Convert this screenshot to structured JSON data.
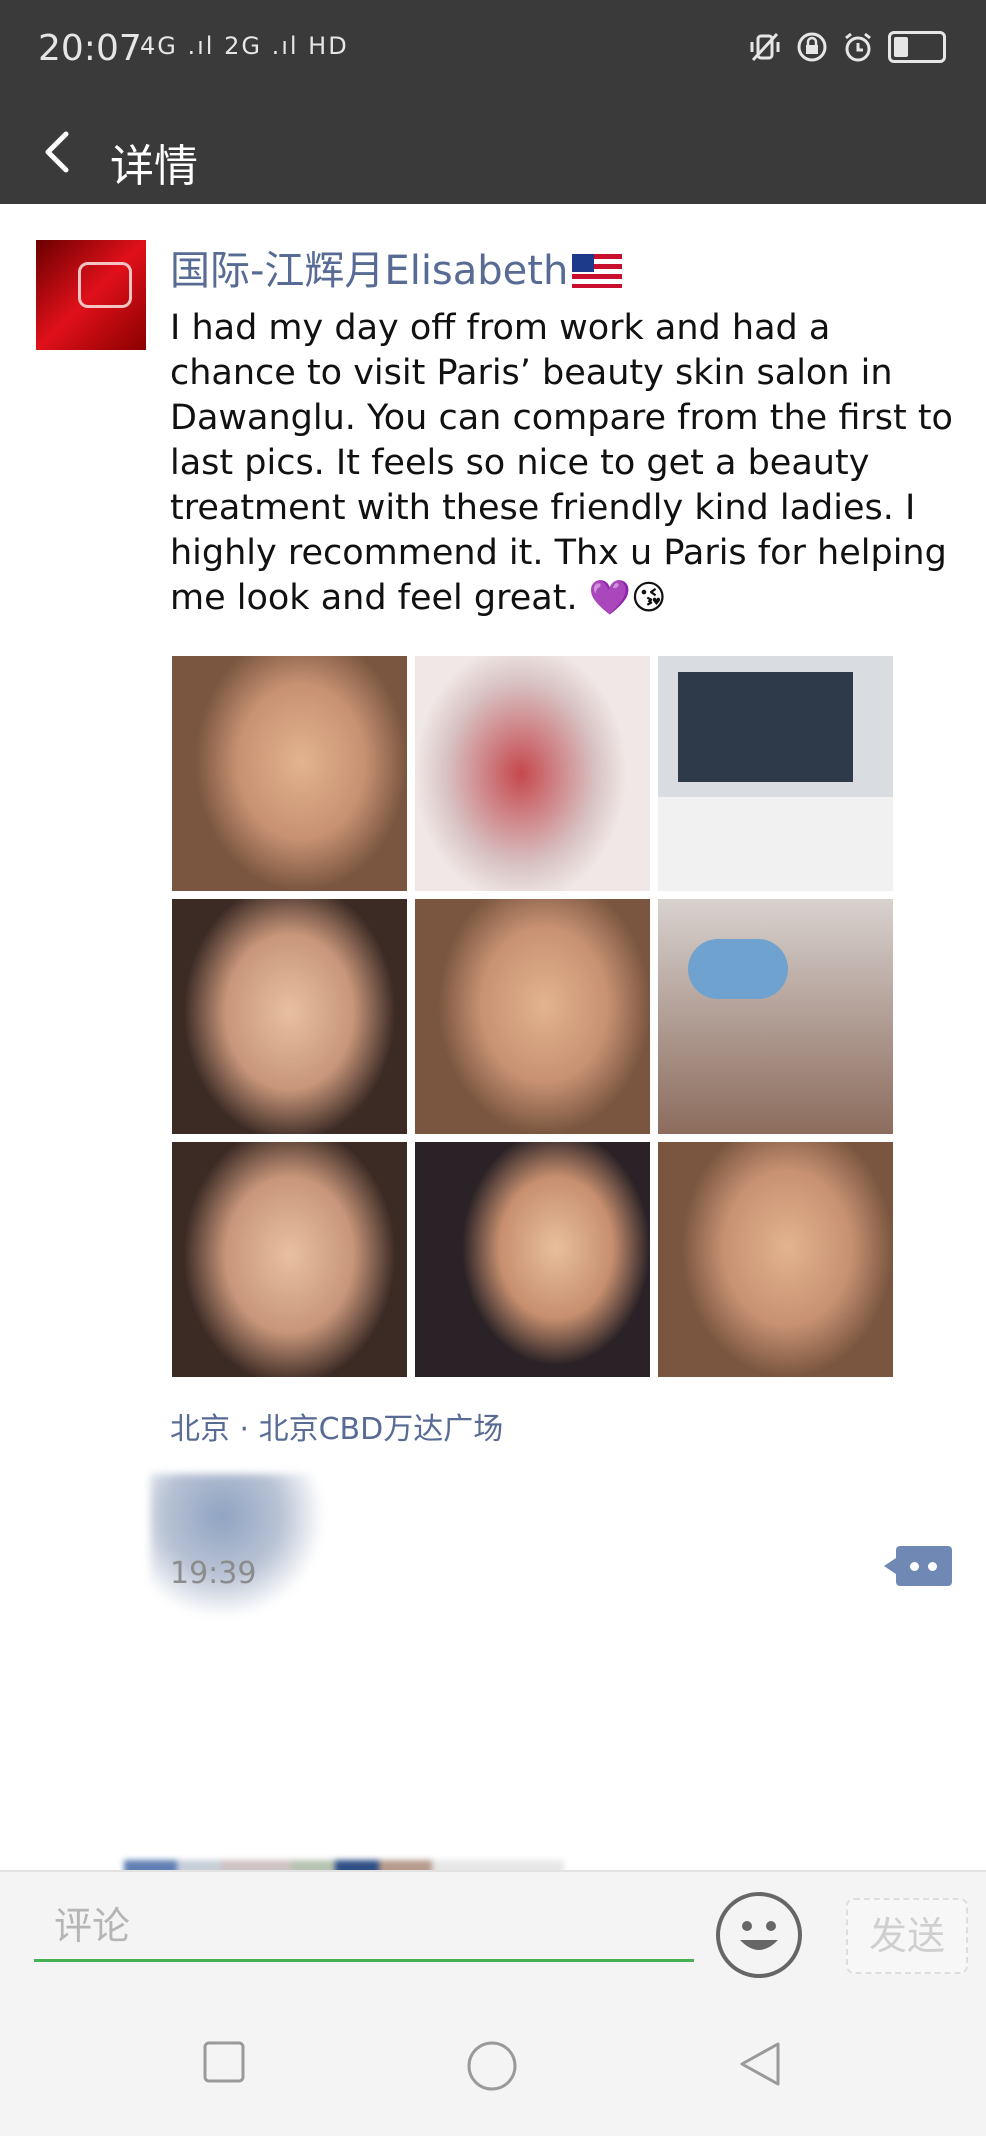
{
  "status_bar": {
    "time": "20:07",
    "network": "4G .ıl 2G .ıl HD",
    "icons": [
      "vibrate-icon",
      "lock-rotation-icon",
      "alarm-icon",
      "battery-icon"
    ]
  },
  "header": {
    "back_icon": "chevron-left-icon",
    "title": "详情"
  },
  "post": {
    "username": "国际-江辉月Elisabeth",
    "text": "I had my day off from work and had a chance to visit Paris’ beauty skin salon in Dawanglu. You can compare from the first to last pics. It feels so nice to get a beauty treatment with these friendly kind ladies. I highly recommend it. Thx u Paris for helping me look and feel great.",
    "emojis": "💜😘",
    "photo_count": 9,
    "location": "北京 · 北京CBD万达广场",
    "time": "19:39"
  },
  "comment_bar": {
    "placeholder": "评论",
    "send_label": "发送"
  },
  "colors": {
    "header_bg": "#3a3a3a",
    "username": "#576b95",
    "input_underline": "#47b052"
  }
}
